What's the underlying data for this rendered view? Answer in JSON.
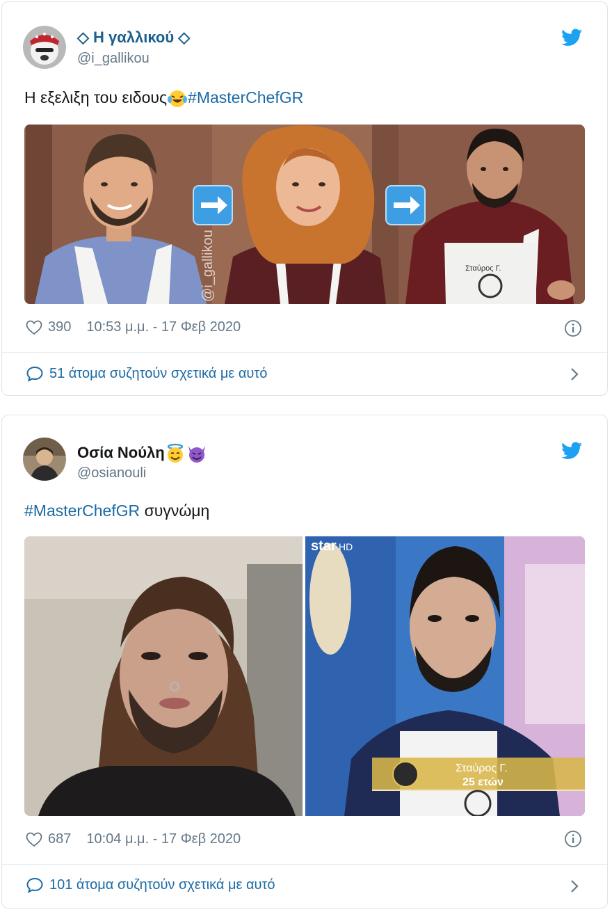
{
  "tweets": [
    {
      "name_prefix": "◇ ",
      "name": "Η γαλλικού",
      "name_suffix": " ◇",
      "handle": "@i_gallikou",
      "text": "Η εξελιξη του ειδους",
      "hashtag": "#MasterChefGR",
      "watermark": "@i_gallikou",
      "apron_label": "Σταύρος Γ.",
      "likes": "390",
      "timestamp": "10:53 μ.μ. - 17 Φεβ 2020",
      "conversation": "51 άτομα συζητούν σχετικά με αυτό"
    },
    {
      "name": "Οσία Νούλη",
      "handle": "@osianouli",
      "hashtag": "#MasterChefGR",
      "text": "συγνώμη",
      "channel": "star",
      "channel_hd": "HD",
      "caption_name": "Σταύρος Γ.",
      "caption_age": "25 ετών",
      "likes": "687",
      "timestamp": "10:04 μ.μ. - 17 Φεβ 2020",
      "conversation": "101 άτομα συζητούν σχετικά με αυτό"
    }
  ],
  "colors": {
    "link": "#1b6aa5",
    "twitter_blue": "#1da1f2",
    "muted": "#657786"
  },
  "icons": [
    "twitter-bird-icon",
    "heart-icon",
    "info-icon",
    "comment-bubble-icon",
    "chevron-right-icon"
  ]
}
